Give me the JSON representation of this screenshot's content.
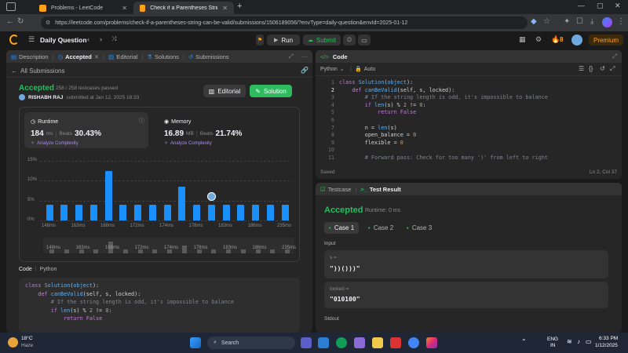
{
  "browser": {
    "tabs": [
      {
        "title": "Problems - LeetCode",
        "active": false
      },
      {
        "title": "Check if a Parentheses String Can",
        "active": true
      }
    ],
    "url": "https://leetcode.com/problems/check-if-a-parentheses-string-can-be-valid/submissions/1506189056/?envType=daily-question&envId=2025-01-12"
  },
  "nav": {
    "title": "Daily Question",
    "run_label": "Run",
    "submit_label": "Submit",
    "streak": "8",
    "premium_label": "Premium"
  },
  "left_tabs": [
    {
      "label": "Description"
    },
    {
      "label": "Accepted"
    },
    {
      "label": "Editorial"
    },
    {
      "label": "Solutions"
    },
    {
      "label": "Submissions"
    }
  ],
  "submission": {
    "back_label": "All Submissions",
    "status": "Accepted",
    "testcases": "258 / 258 testcases passed",
    "user": "RISHABH RAJ",
    "submitted": "submitted at Jan 12, 2025 18:33",
    "editorial_btn": "Editorial",
    "solution_btn": "Solution"
  },
  "runtime": {
    "label": "Runtime",
    "value": "184",
    "unit": "ms",
    "beats_label": "Beats",
    "beats": "30.43%",
    "analyze": "Analyze Complexity"
  },
  "memory": {
    "label": "Memory",
    "value": "16.89",
    "unit": "MB",
    "beats_label": "Beats",
    "beats": "21.74%",
    "analyze": "Analyze Complexity"
  },
  "chart_data": {
    "type": "bar",
    "yticks": [
      "15%",
      "10%",
      "5%",
      "0%"
    ],
    "ylim": [
      0,
      15
    ],
    "x_tick_labels": [
      "148ms",
      "163ms",
      "168ms",
      "172ms",
      "174ms",
      "178ms",
      "183ms",
      "186ms",
      "235ms"
    ],
    "values": [
      4,
      4,
      4,
      4,
      12.5,
      4,
      4,
      4,
      4,
      8.5,
      4,
      4,
      4,
      4,
      4,
      4,
      4
    ],
    "highlight_index": 11,
    "grid": true
  },
  "left_code": {
    "header": "Code",
    "lang": "Python",
    "lines": [
      "class Solution(object):",
      "    def canBeValid(self, s, locked):",
      "        # If the string length is odd, it's impossible to balance",
      "        if len(s) % 2 != 0:",
      "            return False"
    ]
  },
  "editor": {
    "title": "Code",
    "lang": "Python",
    "auto": "Auto",
    "line_numbers": [
      "1",
      "2",
      "3",
      "4",
      "5",
      "6",
      "7",
      "8",
      "9",
      "10",
      "11"
    ],
    "lines": [
      "class Solution(object):",
      "    def canBeValid(self, s, locked):",
      "        # If the string length is odd, it's impossible to balance",
      "        if len(s) % 2 != 0:",
      "            return False",
      "",
      "        n = len(s)",
      "        open_balance = 0",
      "        flexible = 0",
      "",
      "        # Forward pass: Check for too many ')' from left to right"
    ],
    "status_left": "Saved",
    "status_right": "Ln 2, Col 37"
  },
  "testpanel": {
    "tabs": [
      "Testcase",
      "Test Result"
    ],
    "status": "Accepted",
    "runtime": "Runtime: 0 ms",
    "cases": [
      "Case 1",
      "Case 2",
      "Case 3"
    ],
    "input_label": "Input",
    "s_label": "s =",
    "s_value": "\"))()))\"",
    "locked_label": "locked =",
    "locked_value": "\"010100\"",
    "stdout_label": "Stdout"
  },
  "taskbar": {
    "weather_temp": "18°C",
    "weather_desc": "Haze",
    "search": "Search",
    "lang": "ENG",
    "region": "IN",
    "time": "6:33 PM",
    "date": "1/12/2025"
  },
  "colors": {
    "accent_green": "#2cbb5d",
    "accent_orange": "#ffa116",
    "bar_blue": "#1a90ff"
  }
}
